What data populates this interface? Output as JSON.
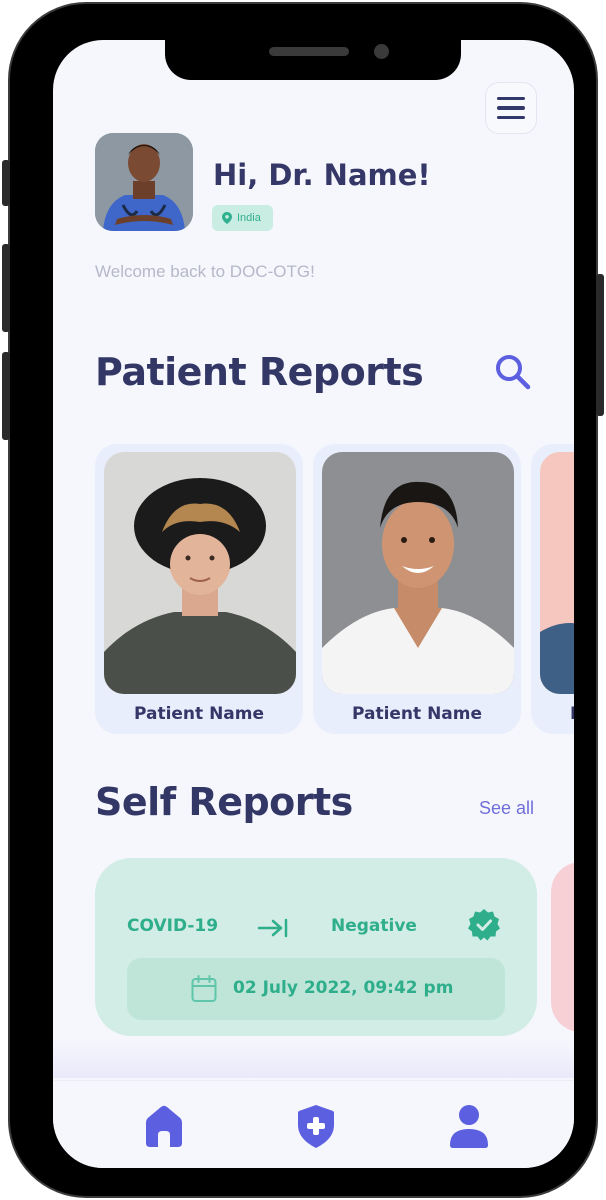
{
  "header": {
    "greeting": "Hi, Dr. Name!",
    "location": "India",
    "welcome": "Welcome back to DOC-OTG!"
  },
  "patient_reports": {
    "title": "Patient Reports",
    "patients": [
      {
        "name": "Patient Name"
      },
      {
        "name": "Patient Name"
      },
      {
        "name": "Patient Name"
      }
    ]
  },
  "self_reports": {
    "title": "Self Reports",
    "see_all": "See all",
    "reports": [
      {
        "test": "COVID-19",
        "result": "Negative",
        "date": "02 July 2022, 09:42 pm"
      }
    ]
  },
  "colors": {
    "primary": "#5b5fe0",
    "heading": "#333766",
    "success": "#2fae8c",
    "card_green": "#d2ede6",
    "card_pink": "#f7d0d6"
  },
  "icons": {
    "menu": "hamburger-icon",
    "search": "search-icon",
    "location": "location-pin-icon",
    "verified": "verified-badge-icon",
    "arrow": "arrow-to-right-icon",
    "calendar": "calendar-icon",
    "nav_home": "home-icon",
    "nav_shield": "shield-plus-icon",
    "nav_profile": "user-icon"
  }
}
